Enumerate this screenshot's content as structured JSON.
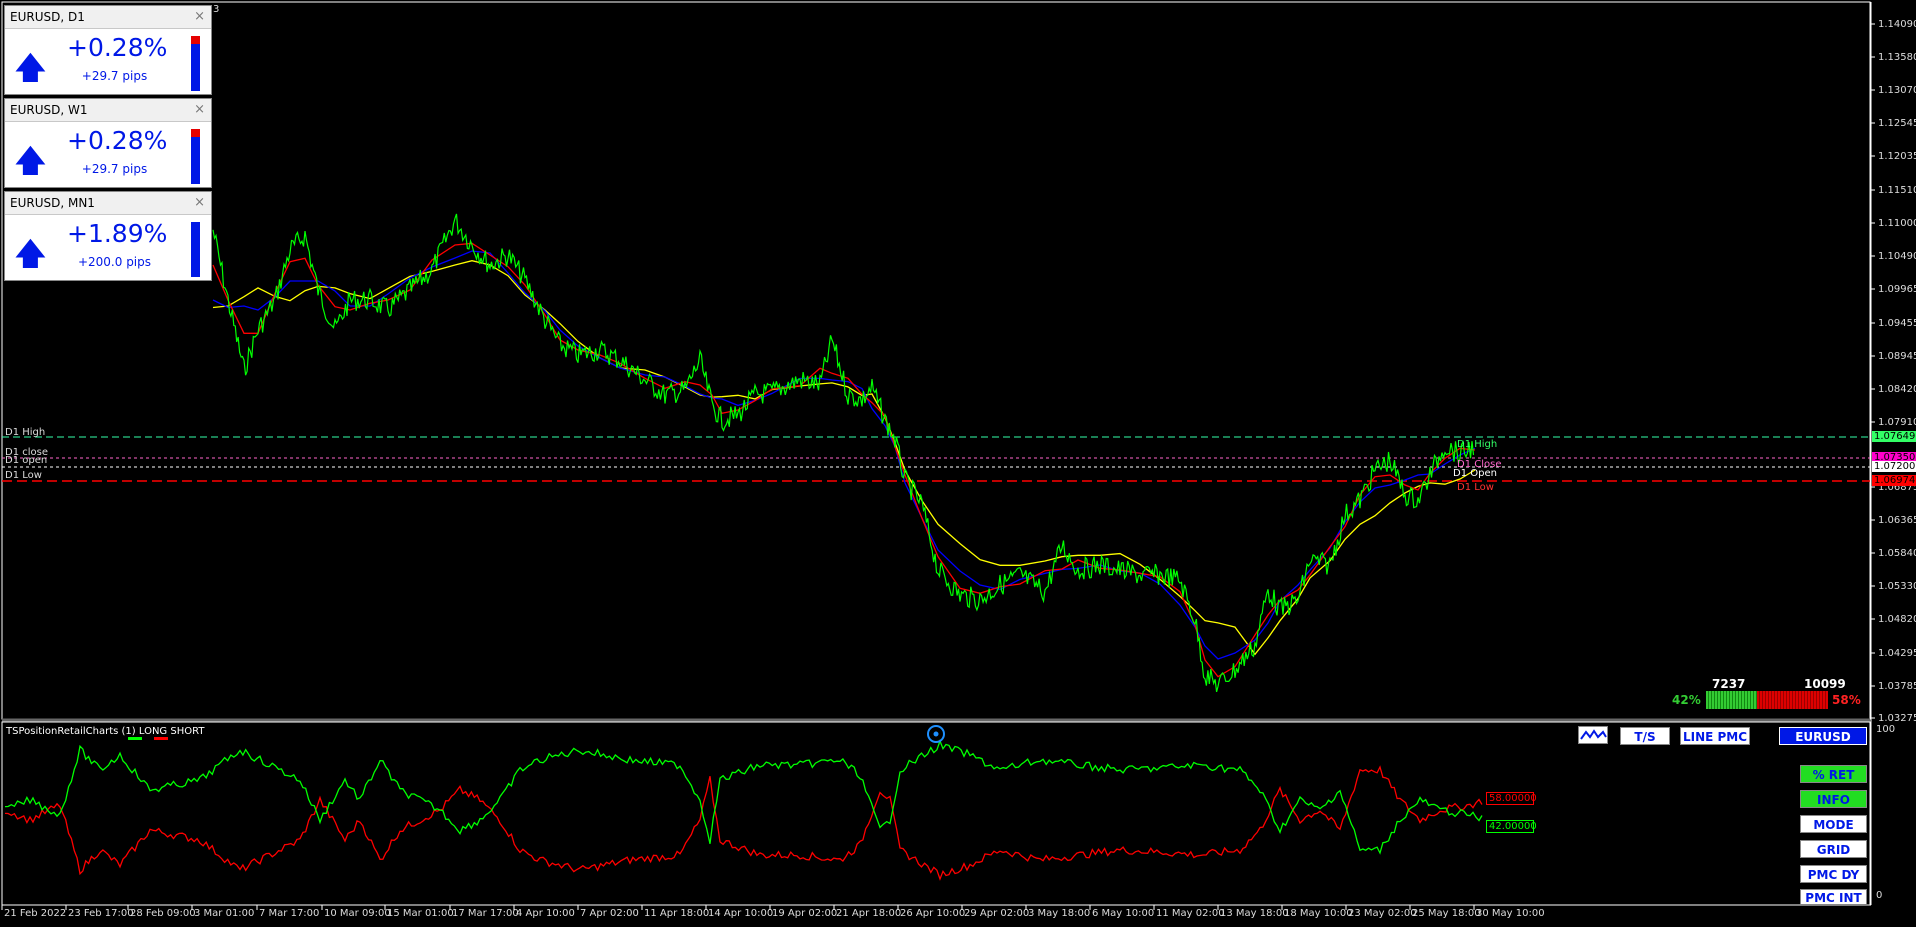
{
  "widgets": [
    {
      "title": "EURUSD, D1",
      "pct": "+0.28%",
      "pips": "+29.7 pips",
      "arrow": "🡅",
      "close": "×",
      "red_fraction": 0.15
    },
    {
      "title": "EURUSD, W1",
      "pct": "+0.28%",
      "pips": "+29.7 pips",
      "arrow": "🡅",
      "close": "×",
      "red_fraction": 0.15
    },
    {
      "title": "EURUSD, MN1",
      "pct": "+1.89%",
      "pips": "+200.0 pips",
      "arrow": "🡅",
      "close": "×",
      "red_fraction": 0.0
    }
  ],
  "price_axis": [
    "1.14090",
    "1.13580",
    "1.13070",
    "1.12545",
    "1.12035",
    "1.11510",
    "1.11000",
    "1.10490",
    "1.09965",
    "1.09455",
    "1.08945",
    "1.08420",
    "1.07910",
    "1.06875",
    "1.06365",
    "1.05840",
    "1.05330",
    "1.04820",
    "1.04295",
    "1.03785",
    "1.03275"
  ],
  "price_tags": {
    "d1_high": {
      "value": "1.07649",
      "color": "#33ff66"
    },
    "d1_close": {
      "value": "1.07350",
      "color": "#ff00cc"
    },
    "d1_open": {
      "value": "1.07200",
      "color": "#ffffff"
    },
    "d1_low": {
      "value": "1.06974",
      "color": "#ff0000"
    }
  },
  "levels": {
    "d1_high_left": "D1 High",
    "d1_close_left": "D1 close",
    "d1_open_left": "D1 open",
    "d1_low_left": "D1 Low",
    "d1_high_right": "D1 High",
    "d1_close_right": "D1 Close",
    "d1_open_right": "D1 Open",
    "d1_low_right": "D1 Low"
  },
  "sentiment": {
    "long_pct": "42%",
    "short_pct": "58%",
    "long_count": "7237",
    "short_count": "10099",
    "long_fraction": 0.42
  },
  "indicator": {
    "title": "TSPositionRetailCharts (1) LONG SHORT",
    "scale_top": "100",
    "scale_bottom": "0",
    "value_short": "58.00000",
    "value_long": "42.00000",
    "top_buttons": [
      "T/S",
      "LINE PMC",
      "EURUSD"
    ],
    "side_buttons": [
      "% RET",
      "INFO",
      "MODE",
      "GRID",
      "PMC DY",
      "PMC INT"
    ],
    "corner_mark": "3"
  },
  "time_axis": [
    "21 Feb 2022",
    "23 Feb 17:00",
    "28 Feb 09:00",
    "3 Mar 01:00",
    "7 Mar 17:00",
    "10 Mar 09:00",
    "15 Mar 01:00",
    "17 Mar 17:00",
    "4 Apr 10:00",
    "7 Apr 02:00",
    "11 Apr 18:00",
    "14 Apr 10:00",
    "19 Apr 02:00",
    "21 Apr 18:00",
    "26 Apr 10:00",
    "29 Apr 02:00",
    "3 May 18:00",
    "6 May 10:00",
    "11 May 02:00",
    "13 May 18:00",
    "18 May 10:00",
    "23 May 02:00",
    "25 May 18:00",
    "30 May 10:00"
  ],
  "colors": {
    "price": "#00ff00",
    "ma_fast": "#ff0000",
    "ma_mid": "#0000ff",
    "ma_slow": "#ffff00",
    "long_line": "#00ff00",
    "short_line": "#ff0000"
  }
}
